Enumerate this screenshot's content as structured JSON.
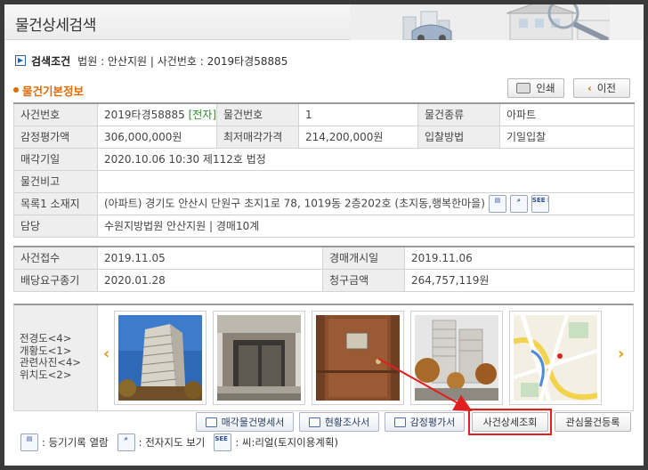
{
  "header": {
    "title": "물건상세검색"
  },
  "search_condition": {
    "label": "검색조건",
    "text": "법원 : 안산지원 | 사건번호 : 2019타경58885"
  },
  "section_title": "물건기본정보",
  "buttons": {
    "print": "인쇄",
    "prev": "이전"
  },
  "basic_info": {
    "case_no_label": "사건번호",
    "case_no_value": "2019타경58885",
    "e_tag": "[전자]",
    "item_no_label": "물건번호",
    "item_no_value": "1",
    "item_type_label": "물건종류",
    "item_type_value": "아파트",
    "appraisal_label": "감정평가액",
    "appraisal_value": "306,000,000원",
    "min_price_label": "최저매각가격",
    "min_price_value": "214,200,000원",
    "bid_method_label": "입찰방법",
    "bid_method_value": "기일입찰",
    "sale_date_label": "매각기일",
    "sale_date_value": "2020.10.06 10:30 제112호 법정",
    "remarks_label": "물건비고",
    "remarks_value": "",
    "address_label": "목록1 소재지",
    "address_value": "(아파트) 경기도 안산시 단원구 초지1로 78, 1019동 2층202호 (초지동,행복한마을)",
    "charge_label": "담당",
    "charge_value": "수원지방법원 안산지원 | 경매10계"
  },
  "case_info": {
    "received_label": "사건접수",
    "received_value": "2019.11.05",
    "auction_start_label": "경매개시일",
    "auction_start_value": "2019.11.06",
    "deadline_label": "배당요구종기",
    "deadline_value": "2020.01.28",
    "claim_label": "청구금액",
    "claim_value": "264,757,119원"
  },
  "photo_labels": [
    "전경도<4>",
    "개황도<1>",
    "관련사진<4>",
    "위치도<2>"
  ],
  "action_buttons": {
    "sale_statement": "매각물건명세서",
    "status_report": "현황조사서",
    "appraisal_report": "감정평가서",
    "case_detail": "사건상세조회",
    "register_interest": "관심물건등록"
  },
  "legend": {
    "registry": ": 등기기록 열람",
    "map": ": 전자지도 보기",
    "seereal": ": 씨:리얼(토지이용계획)",
    "seereal_icon_text": "SEE REAL"
  }
}
